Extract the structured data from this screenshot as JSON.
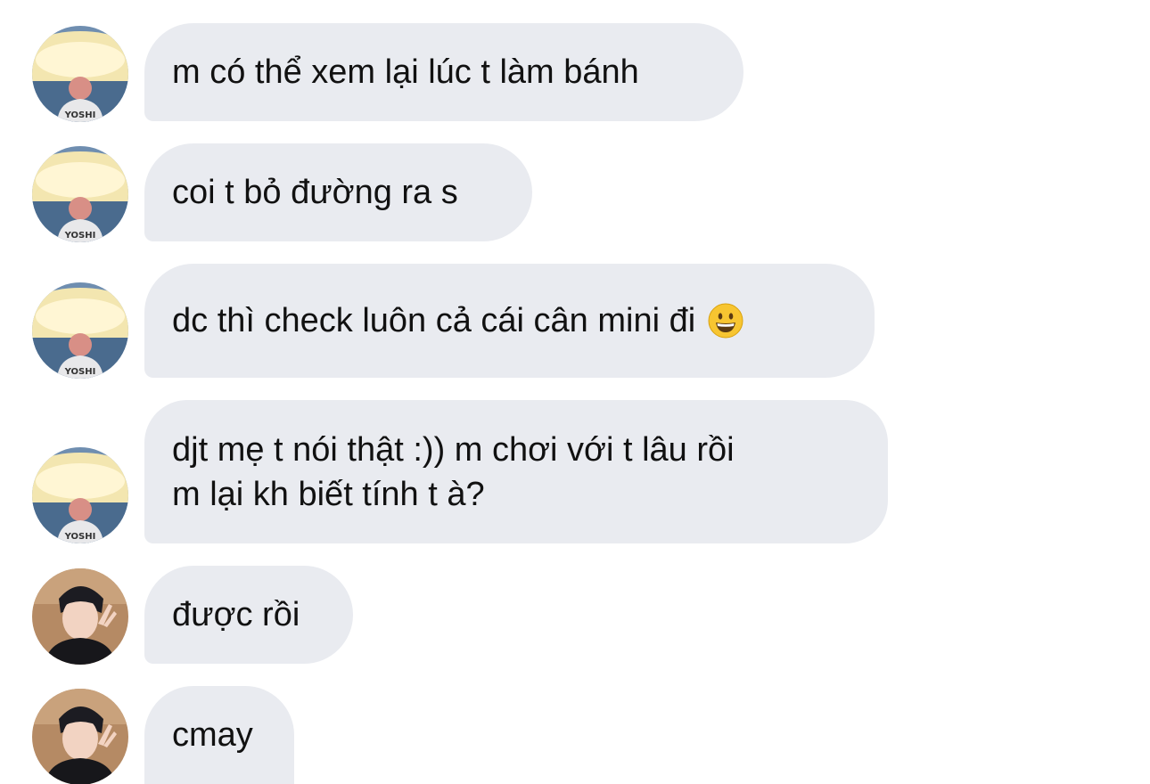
{
  "messages": [
    {
      "sender": "yoshi",
      "text": "m có thể xem lại lúc t làm bánh"
    },
    {
      "sender": "yoshi",
      "text": "coi t bỏ đường ra s"
    },
    {
      "sender": "yoshi",
      "text": "dc thì check luôn cả cái cân mini đi",
      "emoji": "grinning-face-icon"
    },
    {
      "sender": "yoshi",
      "lines": [
        "djt mẹ t nói thật :)) m chơi với t lâu rồi",
        "m lại kh biết tính t à?"
      ]
    },
    {
      "sender": "other",
      "text": "được rồi"
    },
    {
      "sender": "other",
      "text": "cmay"
    }
  ],
  "avatar_badge": "YOSHI",
  "colors": {
    "bubble": "#e9ebf0",
    "text": "#111111",
    "background": "#ffffff"
  }
}
